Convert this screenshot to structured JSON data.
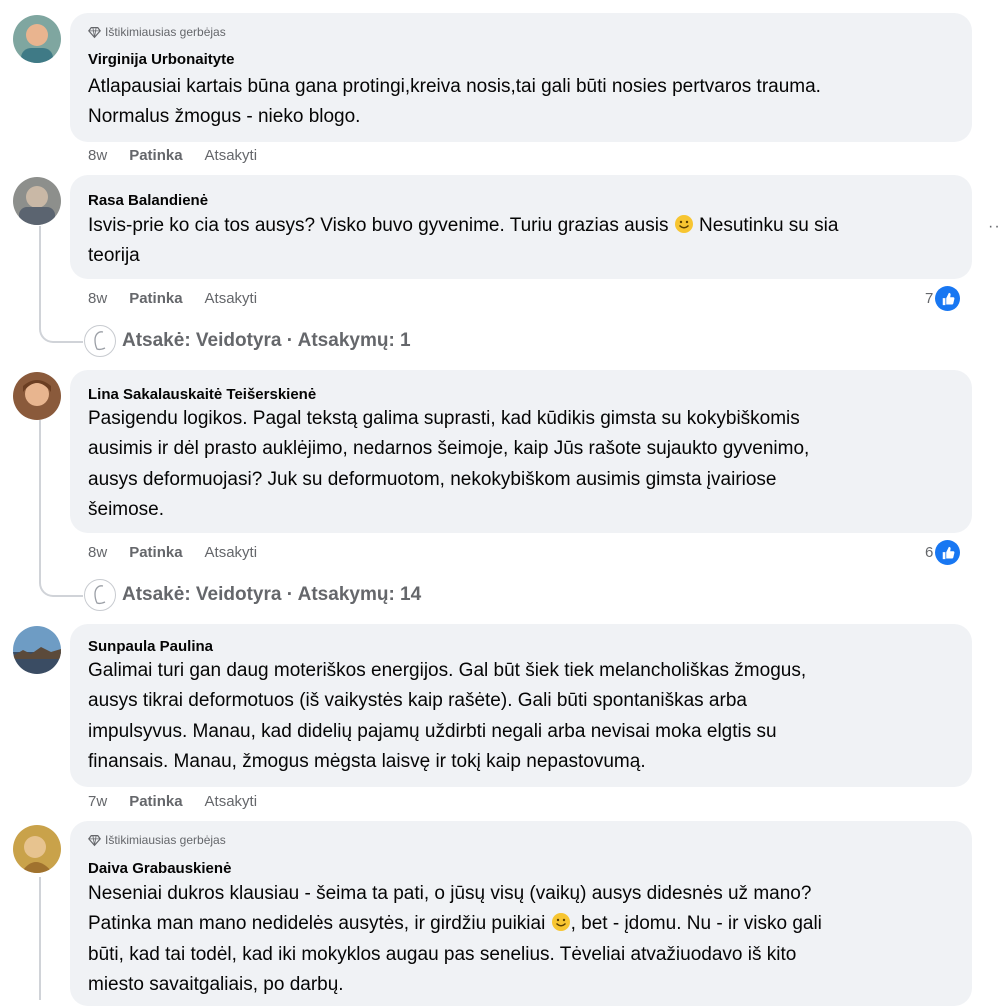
{
  "badge_label": "Ištikimiausias gerbėjas",
  "reply_like_label": "Patinka",
  "reply_answer_label": "Atsakyti",
  "comments": [
    {
      "author": "Virginija Urbonaityte",
      "badge": "Ištikimiausias gerbėjas",
      "lines": [
        "Atlapausiai kartais būna gana protingi,kreiva nosis,tai gali būti nosies pertvaros trauma.",
        "Normalus žmogus - nieko blogo."
      ],
      "time": "8w",
      "like": "Patinka",
      "reply": "Atsakyti"
    },
    {
      "author": "Rasa Balandienė",
      "lines_a": "Isvis-prie ko cia tos ausys? Visko buvo gyvenime. Turiu grazias ausis",
      "lines_b": "Nesutinku su sia",
      "line2": "teorija",
      "time": "8w",
      "like": "Patinka",
      "reply": "Atsakyti",
      "reactions": "7",
      "replies_summary": "Atsakė: Veidotyra · Atsakymų: 1"
    },
    {
      "author": "Lina Sakalauskaitė Teišerskienė",
      "lines": [
        "Pasigendu logikos. Pagal tekstą galima suprasti, kad kūdikis gimsta su kokybiškomis",
        "ausimis ir dėl prasto auklėjimo, nedarnos šeimoje, kaip Jūs rašote sujaukto gyvenimo,",
        "ausys deformuojasi? Juk su deformuotom, nekokybiškom ausimis gimsta įvairiose",
        "šeimose."
      ],
      "time": "8w",
      "like": "Patinka",
      "reply": "Atsakyti",
      "reactions": "6",
      "replies_summary": "Atsakė: Veidotyra · Atsakymų: 14"
    },
    {
      "author": "Sunpaula Paulina",
      "lines": [
        "Galimai turi gan daug moteriškos energijos. Gal būt šiek tiek melancholiškas žmogus,",
        "ausys tikrai deformotuos (iš vaikystės kaip rašėte). Gali būti spontaniškas arba",
        "impulsyvus. Manau, kad didelių pajamų uždirbti negali arba nevisai moka elgtis su",
        "finansais. Manau, žmogus mėgsta laisvę ir tokį kaip nepastovumą."
      ],
      "time": "7w",
      "like": "Patinka",
      "reply": "Atsakyti"
    },
    {
      "author": "Daiva Grabauskienė",
      "badge": "Ištikimiausias gerbėjas",
      "line1": "Neseniai dukros klausiau - šeima ta pati, o jūsų visų (vaikų) ausys didesnės už mano?",
      "line2a": "Patinka man mano nedidelės ausytės, ir girdžiu puikiai",
      "line2b": ", bet - įdomu. Nu - ir visko gali",
      "line3": "būti, kad tai todėl, kad iki mokyklos augau pas senelius. Tėveliai atvažiuodavo iš kito",
      "line4": "miesto savaitgaliais, po darbų."
    }
  ],
  "icons": {
    "badge": "diamond-icon",
    "like": "thumbs-up-icon",
    "emoji": "smiling-face-icon",
    "more": "more-options-icon"
  },
  "colors": {
    "bubble": "#f0f2f5",
    "secondary_text": "#65676b",
    "like_blue": "#1877f2"
  }
}
